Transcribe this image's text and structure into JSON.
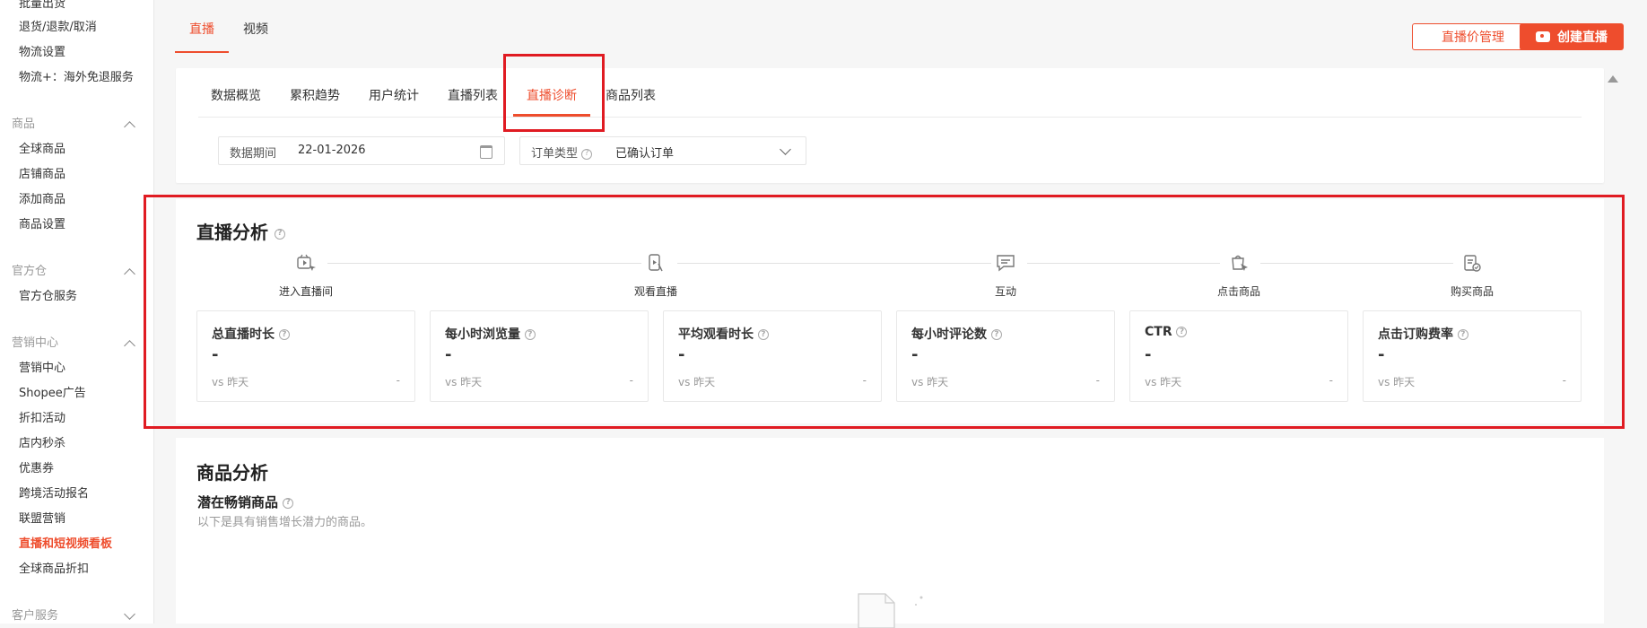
{
  "sidebar": {
    "items_top": [
      "批量出货",
      "退货/退款/取消",
      "物流设置",
      "物流+：海外免退服务"
    ],
    "group_product": "商品",
    "items_product": [
      "全球商品",
      "店铺商品",
      "添加商品",
      "商品设置"
    ],
    "group_warehouse": "官方仓",
    "items_warehouse": [
      "官方仓服务"
    ],
    "group_marketing": "营销中心",
    "items_marketing": [
      "营销中心",
      "Shopee广告",
      "折扣活动",
      "店内秒杀",
      "优惠券",
      "跨境活动报名",
      "联盟营销",
      "直播和短视频看板",
      "全球商品折扣"
    ],
    "group_service": "客户服务"
  },
  "header": {
    "tabs": [
      "直播",
      "视频"
    ],
    "price_mgmt_label": "直播价管理",
    "create_live_label": "创建直播"
  },
  "subtabs": [
    "数据概览",
    "累积趋势",
    "用户统计",
    "直播列表",
    "直播诊断",
    "商品列表"
  ],
  "filters": {
    "period_label": "数据期间",
    "period_value": "22-01-2026",
    "order_type_label": "订单类型",
    "order_type_value": "已确认订单"
  },
  "live_analysis": {
    "title": "直播分析",
    "funnel": [
      "进入直播间",
      "观看直播",
      "互动",
      "点击商品",
      "购买商品"
    ],
    "metrics": [
      {
        "title": "总直播时长",
        "value": "-",
        "vs": "vs 昨天",
        "delta": "-"
      },
      {
        "title": "每小时浏览量",
        "value": "-",
        "vs": "vs 昨天",
        "delta": "-"
      },
      {
        "title": "平均观看时长",
        "value": "-",
        "vs": "vs 昨天",
        "delta": "-"
      },
      {
        "title": "每小时评论数",
        "value": "-",
        "vs": "vs 昨天",
        "delta": "-"
      },
      {
        "title": "CTR",
        "value": "-",
        "vs": "vs 昨天",
        "delta": "-"
      },
      {
        "title": "点击订购费率",
        "value": "-",
        "vs": "vs 昨天",
        "delta": "-"
      }
    ]
  },
  "product_analysis": {
    "title": "商品分析",
    "subtitle": "潜在畅销商品",
    "description": "以下是具有销售增长潜力的商品。"
  },
  "colors": {
    "accent": "#ee4d2d",
    "highlight_box": "#e01b22"
  }
}
